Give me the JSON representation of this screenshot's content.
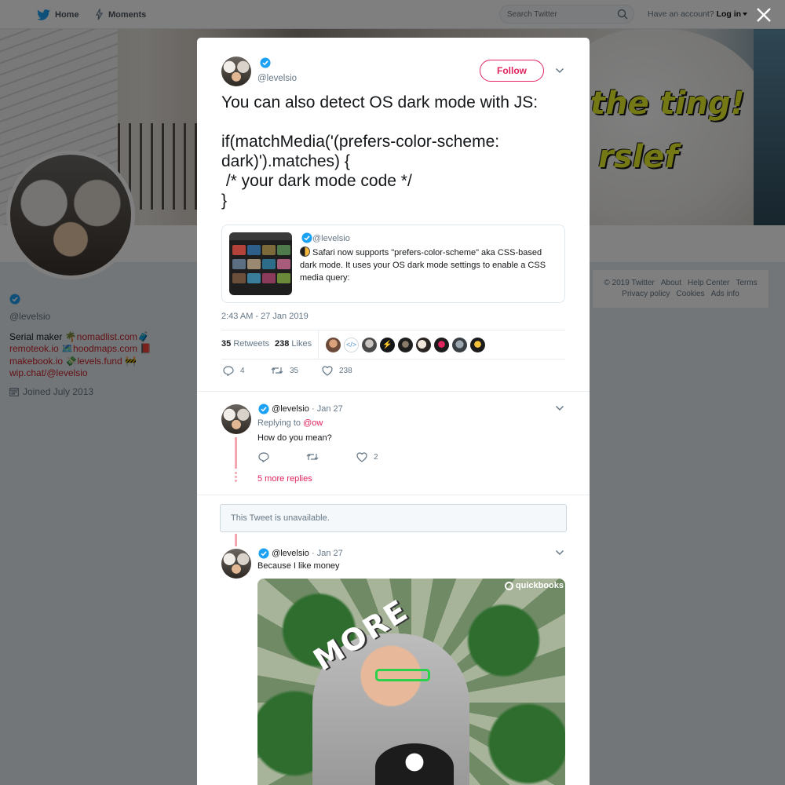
{
  "nav": {
    "home_label": "Home",
    "moments_label": "Moments",
    "search_placeholder": "Search Twitter",
    "account_prompt": "Have an account?",
    "login_label": "Log in"
  },
  "banner": {
    "text_line1": "the ting!",
    "text_line2": "rslef"
  },
  "profile": {
    "handle": "@levelsio",
    "bio_prefix": "Serial maker 🌴",
    "links": [
      "nomadlist.com",
      "remoteok.io",
      "hoodmaps.com",
      "makebook.io",
      "levels.fund",
      "wip.chat/@levelsio"
    ],
    "link_suffixes": [
      "🧳",
      "🗺️",
      "📕",
      "💸",
      "🚧",
      ""
    ],
    "joined": "Joined July 2013"
  },
  "footer": {
    "links_row1": [
      "© 2019 Twitter",
      "About",
      "Help Center",
      "Terms"
    ],
    "links_row2": [
      "Privacy policy",
      "Cookies",
      "Ads info"
    ]
  },
  "tweet": {
    "handle": "@levelsio",
    "follow_label": "Follow",
    "text": "You can also detect OS dark mode with JS:\n\nif(matchMedia('(prefers-color-scheme: dark)').matches) {\n /* your dark mode code */\n}",
    "quote": {
      "handle": "@levelsio",
      "text": "Safari now supports \"prefers-color-scheme\" aka CSS-based dark mode. It uses your OS dark mode settings to enable a CSS media query:"
    },
    "timestamp": "2:43 AM - 27 Jan 2019",
    "retweets_count": "35",
    "retweets_label": "Retweets",
    "likes_count": "238",
    "likes_label": "Likes",
    "likers_count": 9,
    "actions": {
      "replies": "4",
      "retweets": "35",
      "likes": "238"
    }
  },
  "replies": [
    {
      "handle": "@levelsio",
      "date": "· Jan 27",
      "replying_prefix": "Replying to",
      "replying_to": "@ow",
      "text": "How do you mean?",
      "likes": "2",
      "more_replies": "5 more replies"
    },
    {
      "unavailable": "This Tweet is unavailable."
    },
    {
      "handle": "@levelsio",
      "date": "· Jan 27",
      "text": "Because I like money",
      "gif_text": "MORE",
      "gif_brand": "quickbooks"
    }
  ],
  "colors": {
    "accent": "#e0245e",
    "verified": "#1da1f2",
    "link": "#c8232c",
    "banner_text": "#e8f02a"
  }
}
